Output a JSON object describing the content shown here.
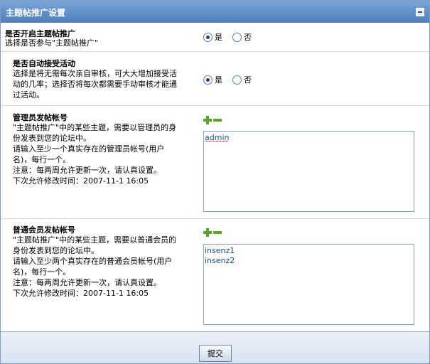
{
  "header": {
    "title": "主题帖推广设置"
  },
  "enable": {
    "title": "是否开启主题帖推广",
    "desc": "选择是否参与\"主题帖推广\"",
    "options": [
      "是",
      "否"
    ],
    "selected": 0
  },
  "auto_accept": {
    "title": "是否自动接受活动",
    "desc_lines": [
      "选择是将无需每次亲自审核，可大大增加接受活",
      "动的几率；选择否将每次都需要手动审核才能通",
      "过活动。"
    ],
    "options": [
      "是",
      "否"
    ],
    "selected": 0
  },
  "admin_account": {
    "title": "管理员发帖帐号",
    "desc_lines": [
      "\"主题帖推广\"中的某些主题，需要以管理员的身",
      "份发表到您的论坛中。",
      "请输入至少一个真实存在的管理员帐号(用户",
      "名)，每行一个。",
      "注意：每两周允许更新一次，请认真设置。",
      "下次允许修改时间：2007-11-1 16:05"
    ],
    "values": [
      "admin"
    ]
  },
  "member_account": {
    "title": "普通会员发帖帐号",
    "desc_lines": [
      "\"主题帖推广\"中的某些主题，需要以普通会员的",
      "身份发表到您的论坛中。",
      "请输入至少两个真实存在的普通会员帐号(用户",
      "名)，每行一个。",
      "注意：每两周允许更新一次，请认真设置。",
      "下次允许修改时间：2007-11-1 16:05"
    ],
    "values": [
      "insenz1",
      "insenz2"
    ]
  },
  "footer": {
    "submit_label": "提交"
  },
  "colors": {
    "header_top": "#7aa5d6",
    "header_bottom": "#4e7fbd",
    "link_text": "#1b4b8f"
  }
}
